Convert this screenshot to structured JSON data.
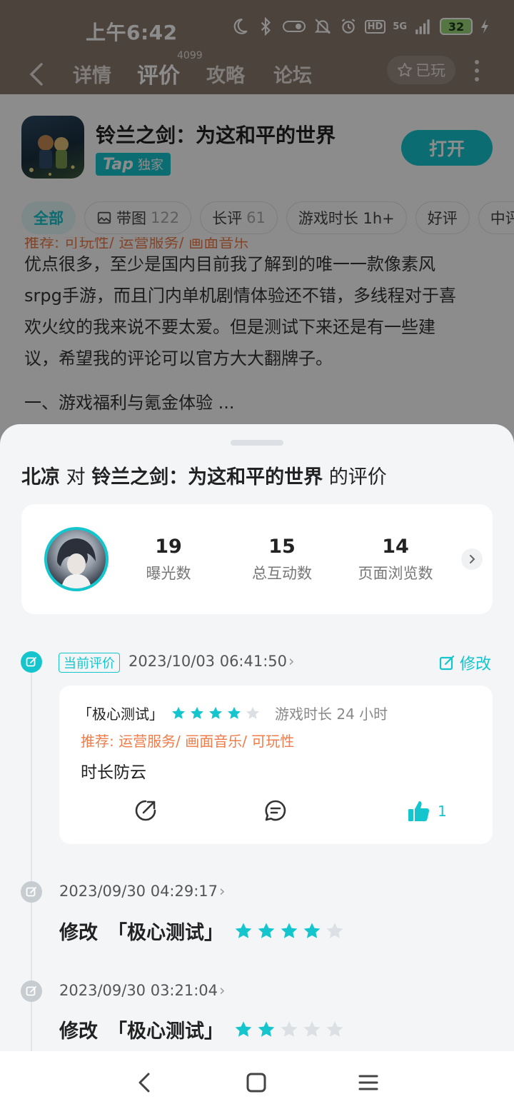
{
  "status_bar": {
    "time": "上午6:42",
    "signal_label": "5G",
    "hd_label": "HD",
    "battery": "32"
  },
  "nav": {
    "tabs": [
      {
        "label": "详情"
      },
      {
        "label": "评价"
      },
      {
        "label": "攻略"
      },
      {
        "label": "论坛"
      }
    ],
    "review_count": "4099",
    "played_label": "已玩"
  },
  "app": {
    "title": "铃兰之剑：为这和平的世界",
    "badge_brand": "Tap",
    "badge_text": "独家",
    "open_label": "打开"
  },
  "filters": [
    {
      "label": "全部",
      "count": ""
    },
    {
      "label": "带图",
      "count": "122"
    },
    {
      "label": "长评",
      "count": "61"
    },
    {
      "label": "游戏时长 1h+",
      "count": ""
    },
    {
      "label": "好评",
      "count": ""
    },
    {
      "label": "中评",
      "count": ""
    }
  ],
  "background_review": {
    "tag_line": "推荐: 可玩性/ 运营服务/ 画面音乐",
    "lines": [
      "优点很多，至少是国内目前我了解到的唯一一款像素风",
      "srpg手游，而且门内单机剧情体验还不错，多线程对于喜",
      "欢火纹的我来说不要太爱。但是测试下来还是有一些建",
      "议，希望我的评论可以官方大大翻牌子。"
    ],
    "section": "一、游戏福利与氪金体验 ..."
  },
  "sheet": {
    "user": "北凉",
    "word_to": "对",
    "game": "铃兰之剑：为这和平的世界",
    "word_suffix": "的评价",
    "stats": [
      {
        "num": "19",
        "label": "曝光数"
      },
      {
        "num": "15",
        "label": "总互动数"
      },
      {
        "num": "14",
        "label": "页面浏览数"
      }
    ],
    "current": {
      "badge": "当前评价",
      "timestamp": "2023/10/03 06:41:50",
      "edit_label": "修改",
      "version": "「极心测试」",
      "rating": 4,
      "playtime": "游戏时长 24 小时",
      "recommend": "推荐: 运营服务/ 画面音乐/ 可玩性",
      "text": "时长防云",
      "like_count": "1"
    },
    "history": [
      {
        "timestamp": "2023/09/30 04:29:17",
        "action": "修改",
        "version": "「极心测试」",
        "rating": 4
      },
      {
        "timestamp": "2023/09/30 03:21:04",
        "action": "修改",
        "version": "「极心测试」",
        "rating": 2
      }
    ]
  },
  "colors": {
    "accent": "#15c5ce",
    "recommend": "#f07c4a",
    "star_empty": "#dcdfe3"
  }
}
